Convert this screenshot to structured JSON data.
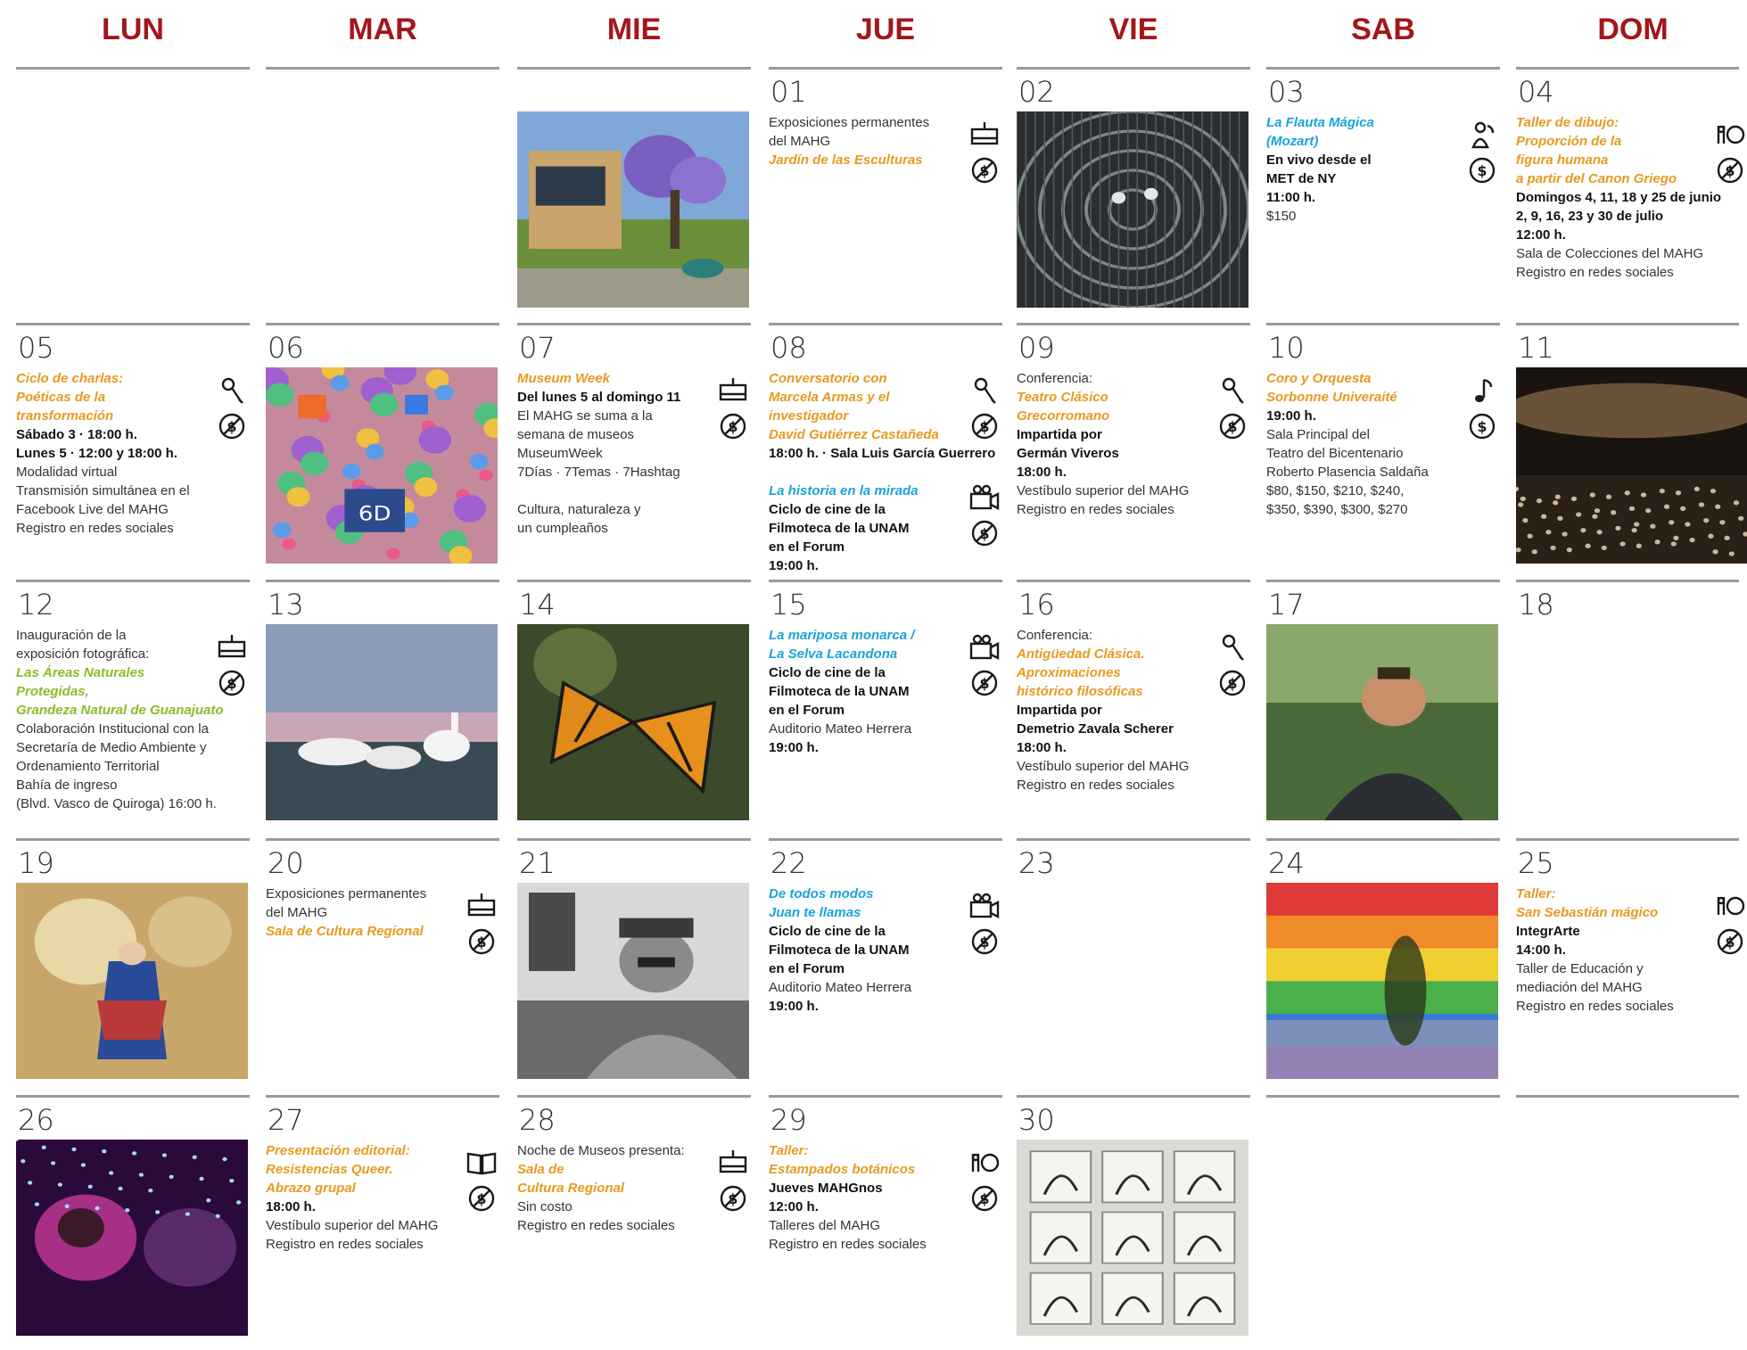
{
  "days_header": [
    "LUN",
    "MAR",
    "MIE",
    "JUE",
    "VIE",
    "SAB",
    "DOM"
  ],
  "days": {
    "01": {
      "num": "01",
      "lines": [
        {
          "t": "Exposiciones permanentes",
          "s": "n"
        },
        {
          "t": "del MAHG",
          "s": "n"
        },
        {
          "t": "Jardín de las Esculturas",
          "s": "o"
        }
      ]
    },
    "02": {
      "num": "02"
    },
    "03": {
      "num": "03",
      "lines": [
        {
          "t": "La Flauta Mágica",
          "s": "c"
        },
        {
          "t": "(Mozart)",
          "s": "c"
        },
        {
          "t": "En vivo desde el",
          "s": "b"
        },
        {
          "t": "MET  de NY",
          "s": "b"
        },
        {
          "t": "11:00 h.",
          "s": "b"
        },
        {
          "t": "$150",
          "s": "n"
        }
      ]
    },
    "04": {
      "num": "04",
      "lines": [
        {
          "t": "Taller de dibujo:",
          "s": "o"
        },
        {
          "t": "Proporción de la",
          "s": "o"
        },
        {
          "t": "figura humana",
          "s": "o"
        },
        {
          "t": "a partir del Canon Griego",
          "s": "o"
        },
        {
          "t": "Domingos 4, 11, 18 y 25 de junio",
          "s": "b"
        },
        {
          "t": "2, 9, 16, 23 y 30 de julio",
          "s": "b"
        },
        {
          "t": "12:00 h.",
          "s": "b"
        },
        {
          "t": "Sala de Colecciones del MAHG",
          "s": "n"
        },
        {
          "t": "Registro en redes sociales",
          "s": "n"
        }
      ]
    },
    "05": {
      "num": "05",
      "lines": [
        {
          "t": "Ciclo de charlas:",
          "s": "o"
        },
        {
          "t": "Poéticas de la",
          "s": "o"
        },
        {
          "t": "transformación",
          "s": "o"
        },
        {
          "t": "Sábado 3 · 18:00 h.",
          "s": "b"
        },
        {
          "t": "Lunes 5 · 12:00 y 18:00 h.",
          "s": "b"
        },
        {
          "t": "Modalidad virtual",
          "s": "n"
        },
        {
          "t": "Transmisión simultánea en el",
          "s": "n"
        },
        {
          "t": "Facebook Live del MAHG",
          "s": "n"
        },
        {
          "t": "Registro en redes sociales",
          "s": "n"
        }
      ]
    },
    "06": {
      "num": "06"
    },
    "07": {
      "num": "07",
      "lines": [
        {
          "t": "Museum Week",
          "s": "o"
        },
        {
          "t": "Del lunes 5 al domingo 11",
          "s": "b"
        },
        {
          "t": "El MAHG se suma a la",
          "s": "n"
        },
        {
          "t": "semana de museos",
          "s": "n"
        },
        {
          "t": "MuseumWeek",
          "s": "n"
        },
        {
          "t": "7Días · 7Temas · 7Hashtag",
          "s": "n"
        },
        {
          "t": "",
          "s": "n"
        },
        {
          "t": "Cultura, naturaleza y",
          "s": "n"
        },
        {
          "t": "un cumpleaños",
          "s": "n"
        }
      ]
    },
    "08": {
      "num": "08",
      "lines": [
        {
          "t": "Conversatorio con",
          "s": "o"
        },
        {
          "t": "Marcela Armas y el",
          "s": "o"
        },
        {
          "t": "investigador",
          "s": "o"
        },
        {
          "t": "David Gutiérrez Castañeda",
          "s": "o"
        },
        {
          "t": "18:00 h. · Sala Luis García Guerrero",
          "s": "b"
        }
      ],
      "lines2": [
        {
          "t": "La historia en la mirada",
          "s": "c"
        },
        {
          "t": "Ciclo de cine de la",
          "s": "b"
        },
        {
          "t": "Filmoteca de la UNAM",
          "s": "b"
        },
        {
          "t": "en el Forum",
          "s": "b"
        },
        {
          "t": "19:00 h.",
          "s": "b"
        }
      ]
    },
    "09": {
      "num": "09",
      "lines": [
        {
          "t": "Conferencia:",
          "s": "n"
        },
        {
          "t": "Teatro Clásico",
          "s": "o"
        },
        {
          "t": "Grecorromano",
          "s": "o"
        },
        {
          "t": "Impartida por",
          "s": "b"
        },
        {
          "t": "Germán Viveros",
          "s": "b"
        },
        {
          "t": "18:00 h.",
          "s": "b"
        },
        {
          "t": "Vestíbulo superior del MAHG",
          "s": "n"
        },
        {
          "t": "Registro en redes sociales",
          "s": "n"
        }
      ]
    },
    "10": {
      "num": "10",
      "lines": [
        {
          "t": "Coro y Orquesta",
          "s": "o"
        },
        {
          "t": "Sorbonne Univeraité",
          "s": "o"
        },
        {
          "t": "19:00 h.",
          "s": "b"
        },
        {
          "t": "Sala Principal del",
          "s": "n"
        },
        {
          "t": "Teatro del Bicentenario",
          "s": "n"
        },
        {
          "t": "Roberto Plasencia Saldaña",
          "s": "n"
        },
        {
          "t": "$80, $150, $210, $240,",
          "s": "n"
        },
        {
          "t": "$350, $390, $300, $270",
          "s": "n"
        }
      ]
    },
    "11": {
      "num": "11"
    },
    "12": {
      "num": "12",
      "lines": [
        {
          "t": "Inauguración de la",
          "s": "n"
        },
        {
          "t": "exposición fotográfica:",
          "s": "n"
        },
        {
          "t": "Las Áreas Naturales",
          "s": "g"
        },
        {
          "t": "Protegidas,",
          "s": "g"
        },
        {
          "t": "Grandeza Natural de Guanajuato",
          "s": "g"
        },
        {
          "t": "Colaboración Institucional con la",
          "s": "n"
        },
        {
          "t": "Secretaría de Medio Ambiente y",
          "s": "n"
        },
        {
          "t": "Ordenamiento Territorial",
          "s": "n"
        },
        {
          "t": "Bahía de ingreso",
          "s": "n"
        },
        {
          "t": "(Blvd. Vasco de Quiroga) 16:00 h.",
          "s": "n"
        }
      ]
    },
    "13": {
      "num": "13"
    },
    "14": {
      "num": "14"
    },
    "15": {
      "num": "15",
      "lines": [
        {
          "t": "La mariposa monarca /",
          "s": "c"
        },
        {
          "t": "La Selva Lacandona",
          "s": "c"
        },
        {
          "t": "Ciclo de cine de la",
          "s": "b"
        },
        {
          "t": "Filmoteca de la UNAM",
          "s": "b"
        },
        {
          "t": "en el Forum",
          "s": "b"
        },
        {
          "t": "Auditorio Mateo Herrera",
          "s": "n"
        },
        {
          "t": "19:00 h.",
          "s": "b"
        }
      ]
    },
    "16": {
      "num": "16",
      "lines": [
        {
          "t": "Conferencia:",
          "s": "n"
        },
        {
          "t": "Antigüedad Clásica.",
          "s": "o"
        },
        {
          "t": "Aproximaciones",
          "s": "o"
        },
        {
          "t": "histórico filosóficas",
          "s": "o"
        },
        {
          "t": "Impartida por",
          "s": "b"
        },
        {
          "t": "Demetrio Zavala Scherer",
          "s": "b"
        },
        {
          "t": "18:00 h.",
          "s": "b"
        },
        {
          "t": "Vestíbulo superior del MAHG",
          "s": "n"
        },
        {
          "t": "Registro en redes sociales",
          "s": "n"
        }
      ]
    },
    "17": {
      "num": "17"
    },
    "18": {
      "num": "18"
    },
    "19": {
      "num": "19"
    },
    "20": {
      "num": "20",
      "lines": [
        {
          "t": "Exposiciones permanentes",
          "s": "n"
        },
        {
          "t": "del MAHG",
          "s": "n"
        },
        {
          "t": "Sala de Cultura Regional",
          "s": "o"
        }
      ]
    },
    "21": {
      "num": "21"
    },
    "22": {
      "num": "22",
      "lines": [
        {
          "t": "De todos modos",
          "s": "c"
        },
        {
          "t": "Juan te llamas",
          "s": "c"
        },
        {
          "t": "Ciclo de cine de la",
          "s": "b"
        },
        {
          "t": "Filmoteca de la UNAM",
          "s": "b"
        },
        {
          "t": "en el Forum",
          "s": "b"
        },
        {
          "t": "Auditorio Mateo Herrera",
          "s": "n"
        },
        {
          "t": "19:00 h.",
          "s": "b"
        }
      ]
    },
    "23": {
      "num": "23"
    },
    "24": {
      "num": "24"
    },
    "25": {
      "num": "25",
      "lines": [
        {
          "t": "Taller:",
          "s": "o"
        },
        {
          "t": "San Sebastián mágico",
          "s": "o"
        },
        {
          "t": "IntegrArte",
          "s": "b"
        },
        {
          "t": "14:00 h.",
          "s": "b"
        },
        {
          "t": "Taller de Educación y",
          "s": "n"
        },
        {
          "t": "mediación del MAHG",
          "s": "n"
        },
        {
          "t": "Registro en redes sociales",
          "s": "n"
        }
      ]
    },
    "26": {
      "num": "26"
    },
    "27": {
      "num": "27",
      "lines": [
        {
          "t": "Presentación editorial:",
          "s": "o"
        },
        {
          "t": "Resistencias Queer.",
          "s": "o"
        },
        {
          "t": "Abrazo grupal",
          "s": "o"
        },
        {
          "t": "18:00 h.",
          "s": "b"
        },
        {
          "t": "Vestíbulo superior del MAHG",
          "s": "n"
        },
        {
          "t": "Registro en redes sociales",
          "s": "n"
        }
      ]
    },
    "28": {
      "num": "28",
      "lines": [
        {
          "t": "Noche de Museos presenta:",
          "s": "n"
        },
        {
          "t": "Sala de",
          "s": "o"
        },
        {
          "t": "Cultura Regional",
          "s": "o"
        },
        {
          "t": "Sin costo",
          "s": "n"
        },
        {
          "t": "Registro en redes sociales",
          "s": "n"
        }
      ]
    },
    "29": {
      "num": "29",
      "lines": [
        {
          "t": "Taller:",
          "s": "o"
        },
        {
          "t": "Estampados botánicos",
          "s": "o"
        },
        {
          "t": "Jueves MAHGnos",
          "s": "b"
        },
        {
          "t": "12:00 h.",
          "s": "b"
        },
        {
          "t": "Talleres del MAHG",
          "s": "n"
        },
        {
          "t": "Registro en redes sociales",
          "s": "n"
        }
      ]
    },
    "30": {
      "num": "30"
    }
  },
  "colors": {
    "header": "#a3161a",
    "orange": "#e69a1f",
    "cyan": "#1aa3d9",
    "green": "#8cbb2a",
    "rule": "#9a9a9a"
  },
  "icons": {
    "01": [
      "easel-icon",
      "free-icon"
    ],
    "03": [
      "opera-singer-icon",
      "cost-icon"
    ],
    "04": [
      "workshop-icon",
      "free-icon"
    ],
    "05": [
      "microphone-icon",
      "free-icon"
    ],
    "07": [
      "easel-icon",
      "free-icon"
    ],
    "08": [
      "microphone-icon",
      "free-icon",
      "film-camera-icon",
      "free-icon"
    ],
    "09": [
      "microphone-icon",
      "free-icon"
    ],
    "10": [
      "music-note-icon",
      "cost-icon"
    ],
    "12": [
      "easel-icon",
      "free-icon"
    ],
    "15": [
      "film-camera-icon",
      "free-icon"
    ],
    "16": [
      "microphone-icon",
      "free-icon"
    ],
    "20": [
      "easel-icon",
      "free-icon"
    ],
    "22": [
      "film-camera-icon",
      "free-icon"
    ],
    "25": [
      "workshop-icon",
      "free-icon"
    ],
    "27": [
      "book-icon",
      "free-icon"
    ],
    "28": [
      "easel-icon",
      "free-icon"
    ],
    "29": [
      "workshop-icon",
      "free-icon"
    ]
  }
}
